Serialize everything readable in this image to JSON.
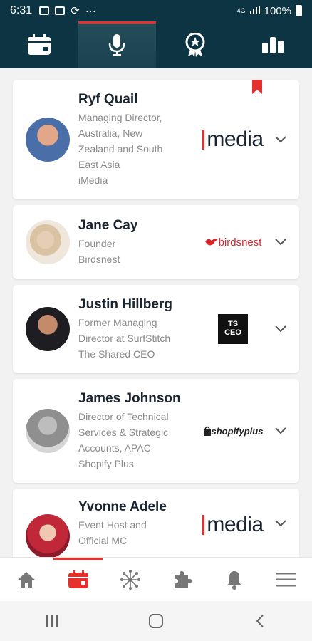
{
  "status_bar": {
    "time": "6:31",
    "dots": "···",
    "network": "4G",
    "battery": "100%"
  },
  "top_tabs": [
    {
      "icon": "calendar-icon",
      "active": false
    },
    {
      "icon": "microphone-icon",
      "active": true
    },
    {
      "icon": "award-icon",
      "active": false
    },
    {
      "icon": "bar-chart-icon",
      "active": false
    }
  ],
  "speakers": [
    {
      "name": "Ryf Quail",
      "lines": [
        "Managing Director,",
        "Australia, New",
        "Zealand and South",
        "East Asia",
        "iMedia"
      ],
      "logo": "imedia",
      "logo_text": "media",
      "bookmarked": true
    },
    {
      "name": "Jane Cay",
      "lines": [
        "Founder",
        "Birdsnest"
      ],
      "logo": "birdsnest",
      "logo_text": "birdsnest",
      "bookmarked": false
    },
    {
      "name": "Justin Hillberg",
      "lines": [
        "Former Managing",
        "Director at SurfStitch",
        "The Shared CEO"
      ],
      "logo": "tsceo",
      "logo_text": "TS CEO",
      "bookmarked": false
    },
    {
      "name": "James Johnson",
      "lines": [
        "Director of Technical",
        "Services & Strategic",
        "Accounts, APAC",
        "Shopify Plus"
      ],
      "logo": "shopify",
      "logo_text": "shopifyplus",
      "bookmarked": false
    },
    {
      "name": "Yvonne Adele",
      "lines": [
        "Event Host and",
        "Official MC"
      ],
      "logo": "imedia",
      "logo_text": "media",
      "bookmarked": false
    }
  ],
  "bottom_nav": [
    {
      "icon": "home-icon",
      "active": false
    },
    {
      "icon": "calendar-icon",
      "active": true
    },
    {
      "icon": "network-icon",
      "active": false
    },
    {
      "icon": "puzzle-icon",
      "active": false
    },
    {
      "icon": "bell-icon",
      "active": false
    },
    {
      "icon": "menu-icon",
      "active": false
    }
  ],
  "colors": {
    "brand_dark": "#0d3442",
    "accent": "#e5302e",
    "text_dark": "#1a2430",
    "text_muted": "#8a8a8a"
  }
}
